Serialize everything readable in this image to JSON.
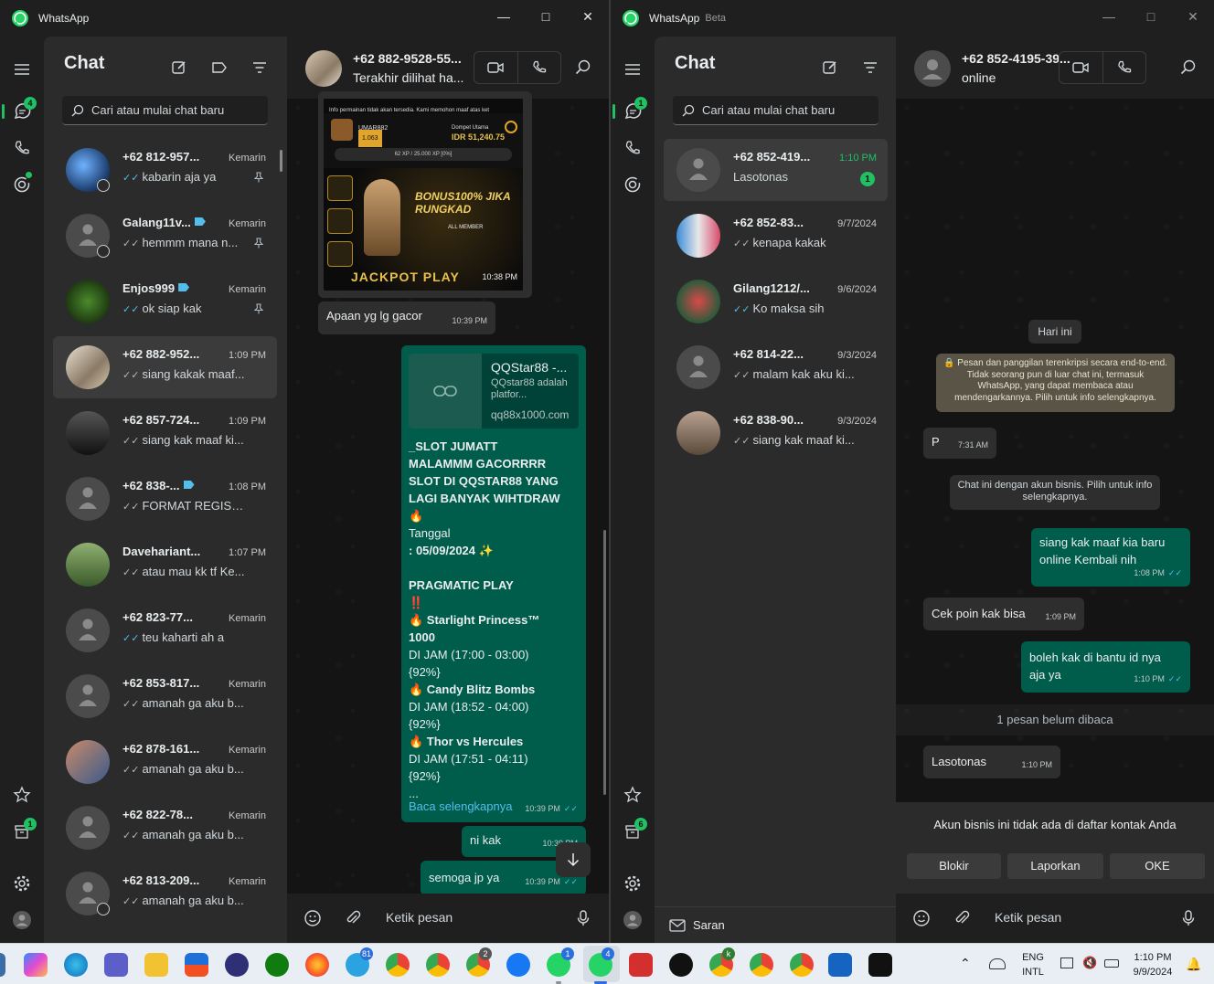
{
  "colors": {
    "accent": "#21c063",
    "outgoing": "#005c4b",
    "incoming": "#2e2e2e",
    "tick_read": "#53bdeb"
  },
  "winA": {
    "app_title": "WhatsApp",
    "rail": {
      "chats_badge": "4",
      "archive_badge": "1"
    },
    "list": {
      "title": "Chat",
      "search_placeholder": "Cari atau mulai chat baru",
      "chats": [
        {
          "name": "+62 812-957...",
          "time": "Kemarin",
          "msg": "kabarin aja ya",
          "pinned": true,
          "tick": "read"
        },
        {
          "name": "Galang11v...",
          "time": "Kemarin",
          "msg": "hemmm mana n...",
          "pinned": true,
          "tick": "sent",
          "label": true
        },
        {
          "name": "Enjos999",
          "time": "Kemarin",
          "msg": "ok siap kak",
          "pinned": true,
          "tick": "read",
          "label": true
        },
        {
          "name": "+62 882-952...",
          "time": "1:09 PM",
          "msg": "siang kakak maaf...",
          "tick": "sent",
          "active": true
        },
        {
          "name": "+62 857-724...",
          "time": "1:09 PM",
          "msg": "siang kak maaf ki...",
          "tick": "sent"
        },
        {
          "name": "+62 838-...",
          "time": "1:08 PM",
          "msg": "FORMAT REGISTR...",
          "tick": "sent",
          "label": true
        },
        {
          "name": "Davehariant...",
          "time": "1:07 PM",
          "msg": "atau mau kk tf Ke...",
          "tick": "sent"
        },
        {
          "name": "+62 823-77...",
          "time": "Kemarin",
          "msg": "teu kaharti ah a",
          "tick": "read"
        },
        {
          "name": "+62 853-817...",
          "time": "Kemarin",
          "msg": "amanah ga aku b...",
          "tick": "sent"
        },
        {
          "name": "+62 878-161...",
          "time": "Kemarin",
          "msg": "amanah ga aku b...",
          "tick": "sent"
        },
        {
          "name": "+62 822-78...",
          "time": "Kemarin",
          "msg": "amanah ga aku b...",
          "tick": "sent"
        },
        {
          "name": "+62 813-209...",
          "time": "Kemarin",
          "msg": "amanah ga aku b...",
          "tick": "sent"
        }
      ]
    },
    "conv": {
      "name": "+62 882-9528-55...",
      "sub": "Terakhir dilihat ha...",
      "promo_banner": {
        "notice": "Info permainan tidak akan tersedia. Kami memohon maaf atas ket",
        "user": "UMAR882",
        "wallet_label": "Dompet Utama",
        "wallet_value": "IDR 51,240.75",
        "level_value": "1.063",
        "xp": "62 XP / 25.000 XP [0%]",
        "bonus": "BONUS100% JIKA RUNGKAD",
        "all_member": "ALL MEMBER",
        "jackpot": "JACKPOT PLAY",
        "time": "10:38 PM"
      },
      "msg_in_1": {
        "text": "Apaan yg lg gacor",
        "time": "10:39 PM"
      },
      "link_preview": {
        "title": "QQStar88 -...",
        "desc": "QQstar88 adalah platfor...",
        "domain": "qq88x1000.com"
      },
      "long_msg": {
        "lines": [
          "_SLOT JUMATT",
          "MALAMMM GACORRRR",
          "SLOT DI QQSTAR88 YANG",
          "LAGI BANYAK WIHTDRAW",
          "🔥",
          "Tanggal",
          ":  05/09/2024 ✨",
          "",
          "PRAGMATIC PLAY",
          "‼️",
          "🔥 Starlight Princess™",
          "1000",
          "DI JAM (17:00 - 03:00)",
          "{92%}",
          "🔥 Candy Blitz Bombs",
          "DI JAM (18:52 -  04:00)",
          "{92%}",
          "🔥 Thor vs Hercules",
          "DI JAM (17:51 - 04:11)",
          "{92%}",
          "..."
        ],
        "read_more": "Baca selengkapnya",
        "time": "10:39 PM"
      },
      "msg_out_2": {
        "text": "ni kak",
        "time": "10:39 PM"
      },
      "msg_out_3": {
        "text": "semoga jp ya",
        "time": "10:39 PM"
      },
      "composer_placeholder": "Ketik pesan"
    }
  },
  "winB": {
    "app_title": "WhatsApp",
    "beta": "Beta",
    "rail": {
      "chats_badge": "1",
      "archive_badge": "6"
    },
    "list": {
      "title": "Chat",
      "search_placeholder": "Cari atau mulai chat baru",
      "chats": [
        {
          "name": "+62 852-419...",
          "time": "1:10 PM",
          "msg": "Lasotonas",
          "unread": "1",
          "active": true
        },
        {
          "name": "+62 852-83...",
          "time": "9/7/2024",
          "msg": "kenapa kakak",
          "tick": "sent"
        },
        {
          "name": "Gilang1212/...",
          "time": "9/6/2024",
          "msg": "Ko maksa sih",
          "tick": "read"
        },
        {
          "name": "+62 814-22...",
          "time": "9/3/2024",
          "msg": "malam kak aku ki...",
          "tick": "sent"
        },
        {
          "name": "+62 838-90...",
          "time": "9/3/2024",
          "msg": "siang kak maaf ki...",
          "tick": "sent"
        }
      ],
      "suggest": "Saran"
    },
    "conv": {
      "name": "+62 852-4195-39...",
      "sub": "online",
      "date_chip": "Hari ini",
      "e2e": "🔒 Pesan dan panggilan terenkripsi secara end-to-end. Tidak seorang pun di luar chat ini, termasuk WhatsApp, yang dapat membaca atau mendengarkannya. Pilih untuk info selengkapnya.",
      "msg_p": {
        "text": "P",
        "time": "7:31 AM"
      },
      "biz_notice": "Chat ini dengan akun bisnis. Pilih untuk info selengkapnya.",
      "out_1": {
        "text": "siang kak maaf kia baru online Kembali nih",
        "time": "1:08 PM"
      },
      "in_2": {
        "text": "Cek poin kak bisa",
        "time": "1:09 PM"
      },
      "out_3": {
        "text": "boleh kak di bantu id nya aja ya",
        "time": "1:10 PM"
      },
      "unread_bar": "1 pesan belum dibaca",
      "in_4": {
        "text": "Lasotonas",
        "time": "1:10 PM"
      },
      "not_contact": "Akun bisnis ini tidak ada di daftar kontak Anda",
      "btn_block": "Blokir",
      "btn_report": "Laporkan",
      "btn_ok": "OKE",
      "composer_placeholder": "Ketik pesan"
    }
  },
  "taskbar": {
    "lang1": "ENG",
    "lang2": "INTL",
    "time": "1:10 PM",
    "date": "9/9/2024",
    "badge_telegram": "81",
    "badge_wa1": "1",
    "badge_wa2": "4",
    "badge_chrome": "2",
    "chrome_k": "k"
  }
}
